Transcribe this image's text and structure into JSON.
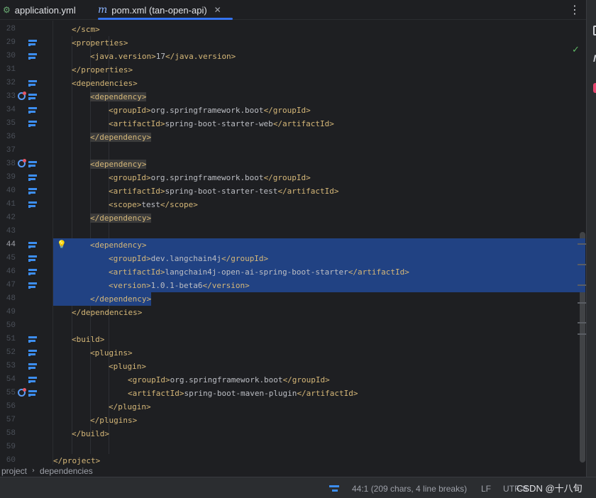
{
  "tabs": [
    {
      "label": "application.yml",
      "icon": "spring-config-icon"
    },
    {
      "label": "pom.xml (tan-open-api)",
      "icon": "maven-icon",
      "active": true
    }
  ],
  "code_lines": [
    {
      "n": "28",
      "indent": 1,
      "parts": [
        [
          "t",
          "</scm>"
        ]
      ]
    },
    {
      "n": "29",
      "indent": 1,
      "gutter": true,
      "parts": [
        [
          "t",
          "<properties>"
        ]
      ]
    },
    {
      "n": "30",
      "indent": 2,
      "gutter": true,
      "parts": [
        [
          "t",
          "<java.version>"
        ],
        [
          "x",
          "17"
        ],
        [
          "t",
          "</java.version>"
        ]
      ]
    },
    {
      "n": "31",
      "indent": 1,
      "parts": [
        [
          "t",
          "</properties>"
        ]
      ]
    },
    {
      "n": "32",
      "indent": 1,
      "gutter": true,
      "parts": [
        [
          "t",
          "<dependencies>"
        ]
      ]
    },
    {
      "n": "33",
      "indent": 2,
      "gutter": true,
      "dep": true,
      "parts": [
        [
          "h",
          "<dependency>"
        ]
      ]
    },
    {
      "n": "34",
      "indent": 3,
      "gutter": true,
      "parts": [
        [
          "t",
          "<groupId>"
        ],
        [
          "x",
          "org.springframework.boot"
        ],
        [
          "t",
          "</groupId>"
        ]
      ]
    },
    {
      "n": "35",
      "indent": 3,
      "gutter": true,
      "parts": [
        [
          "t",
          "<artifactId>"
        ],
        [
          "x",
          "spring-boot-starter-web"
        ],
        [
          "t",
          "</artifactId>"
        ]
      ]
    },
    {
      "n": "36",
      "indent": 2,
      "parts": [
        [
          "h",
          "</dependency>"
        ]
      ]
    },
    {
      "n": "37",
      "indent": 0,
      "parts": []
    },
    {
      "n": "38",
      "indent": 2,
      "gutter": true,
      "dep": true,
      "parts": [
        [
          "h",
          "<dependency>"
        ]
      ]
    },
    {
      "n": "39",
      "indent": 3,
      "gutter": true,
      "parts": [
        [
          "t",
          "<groupId>"
        ],
        [
          "x",
          "org.springframework.boot"
        ],
        [
          "t",
          "</groupId>"
        ]
      ]
    },
    {
      "n": "40",
      "indent": 3,
      "gutter": true,
      "parts": [
        [
          "t",
          "<artifactId>"
        ],
        [
          "x",
          "spring-boot-starter-test"
        ],
        [
          "t",
          "</artifactId>"
        ]
      ]
    },
    {
      "n": "41",
      "indent": 3,
      "gutter": true,
      "parts": [
        [
          "t",
          "<scope>"
        ],
        [
          "x",
          "test"
        ],
        [
          "t",
          "</scope>"
        ]
      ]
    },
    {
      "n": "42",
      "indent": 2,
      "parts": [
        [
          "h",
          "</dependency>"
        ]
      ]
    },
    {
      "n": "43",
      "indent": 0,
      "parts": []
    },
    {
      "n": "44",
      "indent": 2,
      "gutter": true,
      "bulb": true,
      "cur": true,
      "parts": [
        [
          "t",
          "<dependency>"
        ]
      ]
    },
    {
      "n": "45",
      "indent": 3,
      "gutter": true,
      "parts": [
        [
          "t",
          "<groupId>"
        ],
        [
          "x",
          "dev.langchain4j"
        ],
        [
          "t",
          "</groupId>"
        ]
      ]
    },
    {
      "n": "46",
      "indent": 3,
      "gutter": true,
      "parts": [
        [
          "t",
          "<artifactId>"
        ],
        [
          "x",
          "langchain4j-open-ai-spring-boot-starter"
        ],
        [
          "t",
          "</artifactId>"
        ]
      ]
    },
    {
      "n": "47",
      "indent": 3,
      "gutter": true,
      "parts": [
        [
          "t",
          "<version>"
        ],
        [
          "x",
          "1.0.1-beta6"
        ],
        [
          "t",
          "</version>"
        ]
      ]
    },
    {
      "n": "48",
      "indent": 2,
      "parts": [
        [
          "t",
          "</dependency>"
        ]
      ]
    },
    {
      "n": "49",
      "indent": 1,
      "parts": [
        [
          "t",
          "</dependencies>"
        ]
      ]
    },
    {
      "n": "50",
      "indent": 0,
      "parts": []
    },
    {
      "n": "51",
      "indent": 1,
      "gutter": true,
      "parts": [
        [
          "t",
          "<build>"
        ]
      ]
    },
    {
      "n": "52",
      "indent": 2,
      "gutter": true,
      "parts": [
        [
          "t",
          "<plugins>"
        ]
      ]
    },
    {
      "n": "53",
      "indent": 3,
      "gutter": true,
      "parts": [
        [
          "t",
          "<plugin>"
        ]
      ]
    },
    {
      "n": "54",
      "indent": 4,
      "gutter": true,
      "parts": [
        [
          "t",
          "<groupId>"
        ],
        [
          "x",
          "org.springframework.boot"
        ],
        [
          "t",
          "</groupId>"
        ]
      ]
    },
    {
      "n": "55",
      "indent": 4,
      "gutter": true,
      "dep": true,
      "parts": [
        [
          "t",
          "<artifactId>"
        ],
        [
          "x",
          "spring-boot-maven-plugin"
        ],
        [
          "t",
          "</artifactId>"
        ]
      ]
    },
    {
      "n": "56",
      "indent": 3,
      "parts": [
        [
          "t",
          "</plugin>"
        ]
      ]
    },
    {
      "n": "57",
      "indent": 2,
      "parts": [
        [
          "t",
          "</plugins>"
        ]
      ]
    },
    {
      "n": "58",
      "indent": 1,
      "parts": [
        [
          "t",
          "</build>"
        ]
      ]
    },
    {
      "n": "59",
      "indent": 0,
      "parts": []
    },
    {
      "n": "60",
      "indent": 0,
      "parts": [
        [
          "t",
          "</project>"
        ]
      ]
    }
  ],
  "breadcrumb": [
    "project",
    "dependencies"
  ],
  "status": {
    "position": "44:1 (209 chars, 4 line breaks)",
    "line_separator": "LF",
    "encoding": "UTF-8"
  },
  "watermark": "CSDN @十八旬",
  "colors": {
    "accent": "#3574f0",
    "selection": "#214283",
    "tag": "#d5b778",
    "text": "#bcbec4"
  }
}
